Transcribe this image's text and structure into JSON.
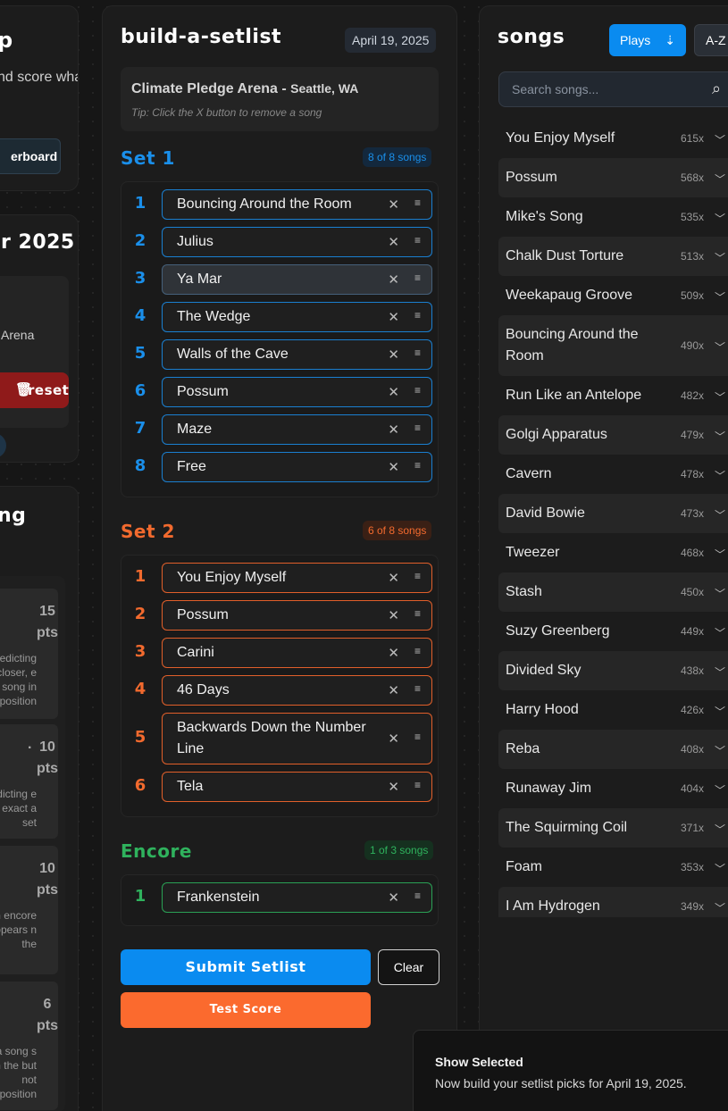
{
  "left": {
    "panel1": {
      "title": "p",
      "text": "nd score what",
      "button": "erboard"
    },
    "panel2": {
      "title": "r 2025",
      "venue": "Arena",
      "reset_label": "reset",
      "reset_icon": "trash-icon"
    },
    "panel3": {
      "title": "ng",
      "cards": [
        {
          "points": "15",
          "unit": "pts",
          "desc": "redicting closer, e song in position"
        },
        {
          "points": "10",
          "unit": "pts",
          "desc": "redicting e exact a set"
        },
        {
          "points": "10",
          "unit": "pts",
          "desc": "an encore ppears n the"
        },
        {
          "points": "6",
          "unit": "pts",
          "desc": "a song s in the but not position"
        }
      ]
    }
  },
  "builder": {
    "title": "build-a-setlist",
    "date": "April 19, 2025",
    "venue": "Climate Pledge Arena -",
    "city": "Seattle, WA",
    "tip": "Tip: Click the X button to remove a song",
    "sets": [
      {
        "title": "Set 1",
        "count": "8 of 8 songs",
        "color": "#1a8fea",
        "songs": [
          "Bouncing Around the Room",
          "Julius",
          "Ya Mar",
          "The Wedge",
          "Walls of the Cave",
          "Possum",
          "Maze",
          "Free"
        ]
      },
      {
        "title": "Set 2",
        "count": "6 of 8 songs",
        "color": "#f26a2e",
        "songs": [
          "You Enjoy Myself",
          "Possum",
          "Carini",
          "46 Days",
          "Backwards Down the Number Line",
          "Tela"
        ]
      },
      {
        "title": "Encore",
        "count": "1 of 3 songs",
        "color": "#2fb25d",
        "songs": [
          "Frankenstein"
        ]
      }
    ],
    "submit_label": "Submit Setlist",
    "clear_label": "Clear",
    "test_label": "Test Score"
  },
  "songs": {
    "title": "songs",
    "sort_plays": "Plays",
    "sort_az": "A-Z",
    "search_placeholder": "Search songs...",
    "list": [
      {
        "name": "You Enjoy Myself",
        "plays": "615x"
      },
      {
        "name": "Possum",
        "plays": "568x"
      },
      {
        "name": "Mike's Song",
        "plays": "535x"
      },
      {
        "name": "Chalk Dust Torture",
        "plays": "513x"
      },
      {
        "name": "Weekapaug Groove",
        "plays": "509x"
      },
      {
        "name": "Bouncing Around the Room",
        "plays": "490x"
      },
      {
        "name": "Run Like an Antelope",
        "plays": "482x"
      },
      {
        "name": "Golgi Apparatus",
        "plays": "479x"
      },
      {
        "name": "Cavern",
        "plays": "478x"
      },
      {
        "name": "David Bowie",
        "plays": "473x"
      },
      {
        "name": "Tweezer",
        "plays": "468x"
      },
      {
        "name": "Stash",
        "plays": "450x"
      },
      {
        "name": "Suzy Greenberg",
        "plays": "449x"
      },
      {
        "name": "Divided Sky",
        "plays": "438x"
      },
      {
        "name": "Harry Hood",
        "plays": "426x"
      },
      {
        "name": "Reba",
        "plays": "408x"
      },
      {
        "name": "Runaway Jim",
        "plays": "404x"
      },
      {
        "name": "The Squirming Coil",
        "plays": "371x"
      },
      {
        "name": "Foam",
        "plays": "353x"
      },
      {
        "name": "I Am Hydrogen",
        "plays": "349x"
      }
    ]
  },
  "toast": {
    "title": "Show Selected",
    "message": "Now build your setlist picks for April 19, 2025."
  }
}
